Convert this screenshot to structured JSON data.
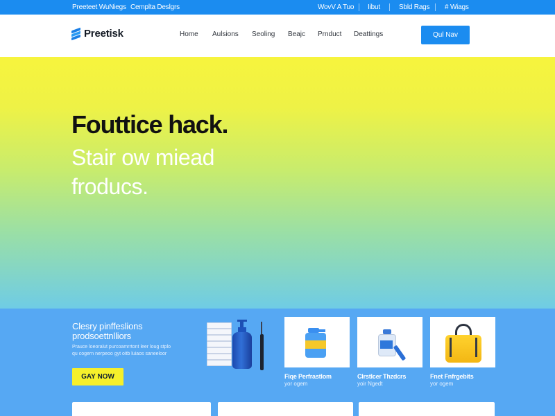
{
  "topbar": {
    "left": [
      "Preeteet WuNiegs",
      "Cemplta Deslgrs"
    ],
    "right": [
      "WovV A Tuo",
      "Iibut",
      "Sbld Rags",
      "# Wiags"
    ]
  },
  "header": {
    "logo_text": "Preetisk",
    "nav": [
      "Home",
      "Aulsions",
      "Seoling",
      "Beajc",
      "Prnduct",
      "Deattings"
    ],
    "cta": "Qul Nav"
  },
  "hero": {
    "title": "Fouttice hack.",
    "subtitle_line1": "Stair ow miead",
    "subtitle_line2": "froducs."
  },
  "band": {
    "title_line1": "Clesry pinffeslions",
    "title_line2": "prodsoettnlliors",
    "desc_line1": "Prauce loeoralut purcoamrrtont leer loug stplo",
    "desc_line2": "qu cogern nerpeoo gyt oitb luiaos saneeloor",
    "button": "GAY NOW",
    "cards": [
      {
        "name": "Fiqe Perfrastlom",
        "sub": "yor ogem"
      },
      {
        "name": "Clrstlcer Thzdcrs",
        "sub": "yoir Ngedt"
      },
      {
        "name": "Fnet Fnfrgebits",
        "sub": "yor ogem"
      }
    ]
  },
  "colors": {
    "accent_blue": "#1b8cf0",
    "band_blue": "#56a8f3",
    "button_yellow": "#f6f02b",
    "hero_top": "#f7f43d",
    "hero_bottom": "#6fcce5"
  }
}
